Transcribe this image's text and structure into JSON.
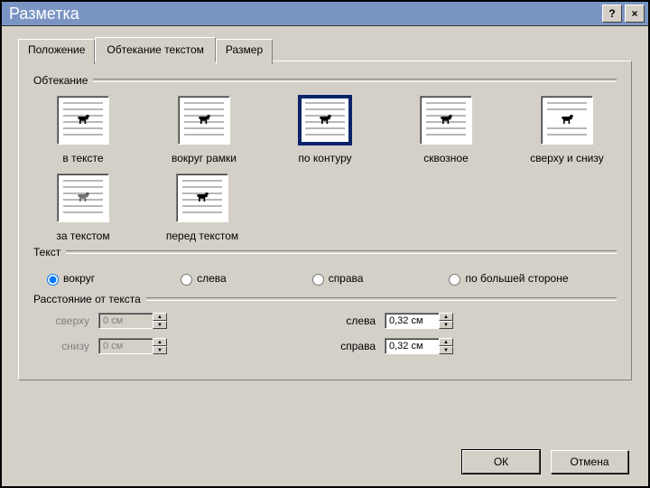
{
  "window": {
    "title": "Разметка"
  },
  "tabs": {
    "position": "Положение",
    "wrapping": "Обтекание текстом",
    "size": "Размер"
  },
  "groups": {
    "wrapping": "Обтекание",
    "text": "Текст",
    "distance": "Расстояние от текста"
  },
  "wrap_options": {
    "inline": "в тексте",
    "square": "вокруг рамки",
    "tight": "по контуру",
    "through": "сквозное",
    "topbottom": "сверху и снизу",
    "behind": "за текстом",
    "front": "перед текстом",
    "selected": "tight"
  },
  "text_opts": {
    "around": "вокруг",
    "left": "слева",
    "right": "справа",
    "largest": "по большей стороне",
    "selected": "around"
  },
  "distance": {
    "top_label": "сверху",
    "top_value": "0 см",
    "bottom_label": "снизу",
    "bottom_value": "0 см",
    "left_label": "слева",
    "left_value": "0,32 см",
    "right_label": "справа",
    "right_value": "0,32 см"
  },
  "buttons": {
    "ok": "ОК",
    "cancel": "Отмена"
  }
}
